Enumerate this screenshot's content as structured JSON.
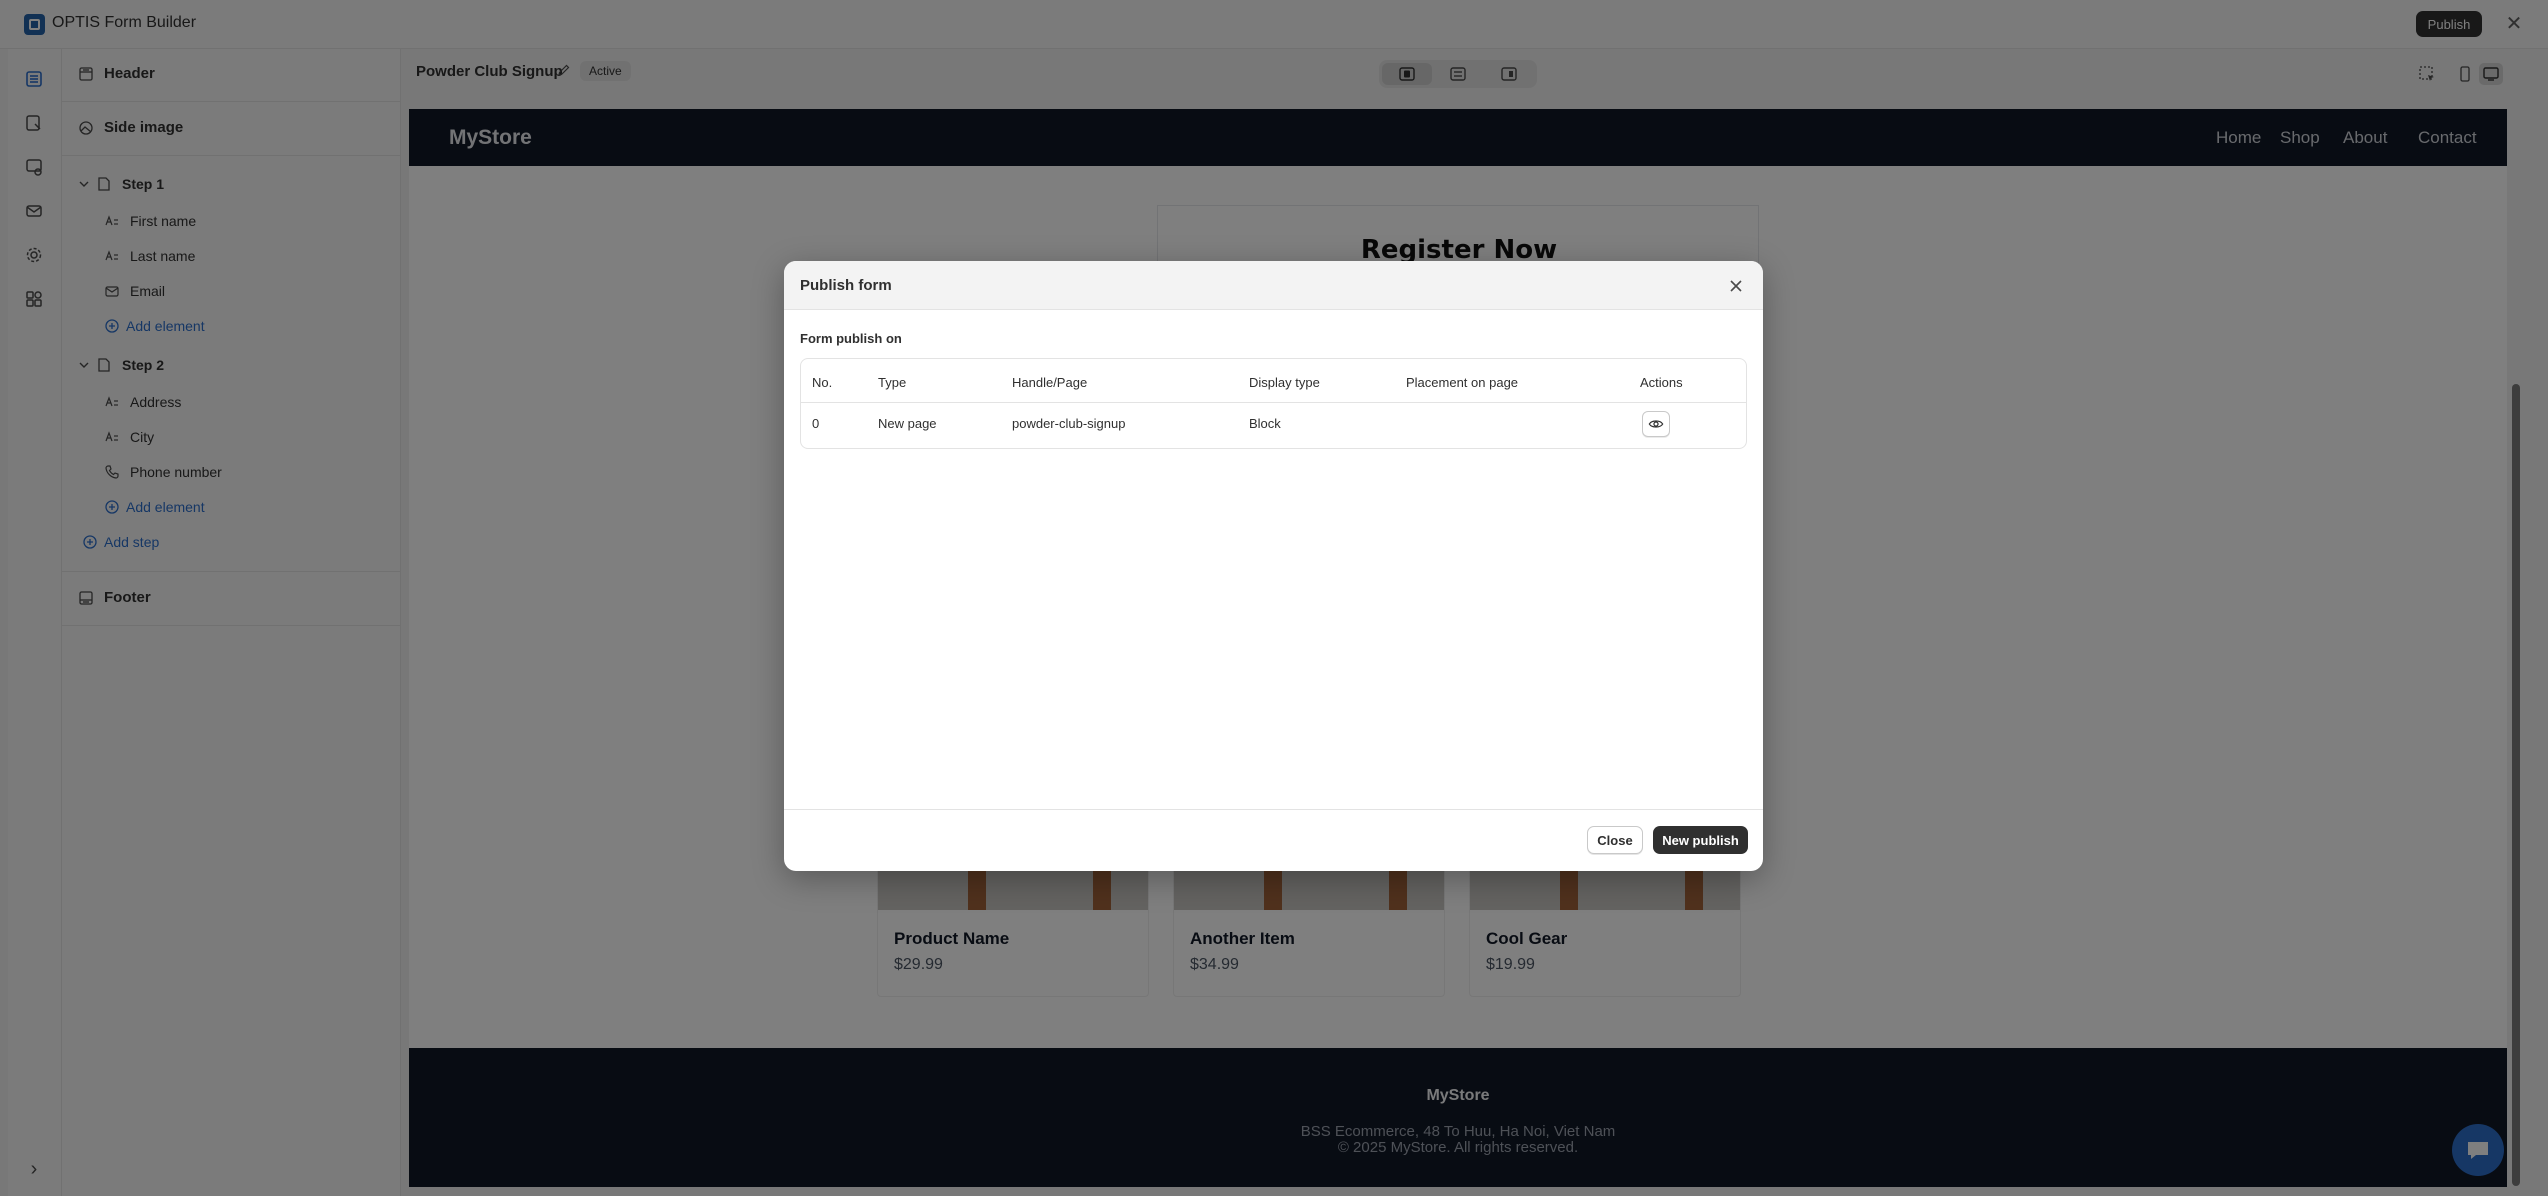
{
  "app": {
    "title": "OPTIS Form Builder",
    "publish_label": "Publish",
    "close_glyph": "✕"
  },
  "sidebar": {
    "header": "Header",
    "side_image": "Side image",
    "steps": [
      {
        "label": "Step 1",
        "fields": [
          "First name",
          "Last name",
          "Email"
        ],
        "add_element": "Add element"
      },
      {
        "label": "Step 2",
        "fields": [
          "Address",
          "City",
          "Phone number"
        ],
        "add_element": "Add element"
      }
    ],
    "add_step": "Add step",
    "footer": "Footer",
    "expand_glyph": "›"
  },
  "toolbar": {
    "form_name": "Powder Club Signup",
    "status": "Active"
  },
  "preview": {
    "brand": "MyStore",
    "nav": [
      "Home",
      "Shop",
      "About",
      "Contact"
    ],
    "register_title": "Register Now",
    "products": [
      {
        "name": "Product Name",
        "price": "$29.99"
      },
      {
        "name": "Another Item",
        "price": "$34.99"
      },
      {
        "name": "Cool Gear",
        "price": "$19.99"
      }
    ],
    "footer": {
      "brand": "MyStore",
      "address": "BSS Ecommerce, 48 To Huu, Ha Noi, Viet Nam",
      "copyright": "© 2025 MyStore. All rights reserved."
    }
  },
  "modal": {
    "title": "Publish form",
    "section_label": "Form publish on",
    "columns": [
      "No.",
      "Type",
      "Handle/Page",
      "Display type",
      "Placement on page",
      "Actions"
    ],
    "rows": [
      {
        "no": "0",
        "type": "New page",
        "handle": "powder-club-signup",
        "display": "Block",
        "placement": ""
      }
    ],
    "close_label": "Close",
    "new_publish_label": "New publish"
  },
  "colors": {
    "accent": "#2c6ecb",
    "dark": "#303030",
    "store_header": "#111827"
  }
}
